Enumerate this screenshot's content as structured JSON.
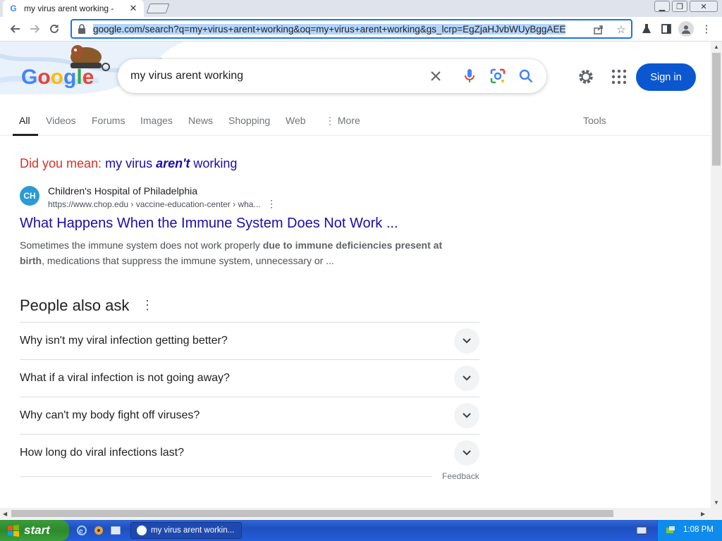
{
  "browser": {
    "tab_title": "my virus arent working -",
    "tab_close": "✕",
    "url": "google.com/search?q=my+virus+arent+working&oq=my+virus+arent+working&gs_lcrp=EgZjaHJvbWUyBggAEE"
  },
  "search": {
    "query": "my virus arent working",
    "sign_in": "Sign in",
    "tabs": [
      "All",
      "Videos",
      "Forums",
      "Images",
      "News",
      "Shopping",
      "Web"
    ],
    "more": "More",
    "tools": "Tools"
  },
  "did_you_mean": {
    "label": "Did you mean:",
    "before": "my virus",
    "emphasis": "aren't",
    "after": "working"
  },
  "result": {
    "logo_text": "CH",
    "site_name": "Children's Hospital of Philadelphia",
    "url": "https://www.chop.edu › vaccine-education-center › wha...",
    "title": "What Happens When the Immune System Does Not Work ...",
    "snippet_1": "Sometimes the immune system does not work properly ",
    "snippet_bold_1": "due to immune deficiencies present at",
    "snippet_bold_2": "birth",
    "snippet_2": ", medications that suppress the immune system, unnecessary or ..."
  },
  "people_also_ask": {
    "title": "People also ask",
    "questions": [
      "Why isn't my viral infection getting better?",
      "What if a viral infection is not going away?",
      "Why can't my body fight off viruses?",
      "How long do viral infections last?"
    ],
    "feedback": "Feedback"
  },
  "taskbar": {
    "start": "start",
    "task_item": "my virus arent workin...",
    "clock": "1:08 PM"
  },
  "colors": {
    "link": "#1a0dab",
    "accent": "#0b57d0",
    "did_you_mean_label": "#d93025"
  }
}
